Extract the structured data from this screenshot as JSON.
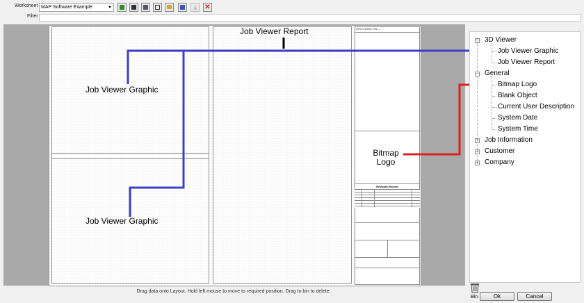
{
  "toolbar": {
    "worksheet_label": "Worksheet",
    "worksheet_value": "MAP Software Example",
    "filter_label": "Filter"
  },
  "layout": {
    "title_block_header": "ARCH BASE ON ---",
    "revision_record": "Revision Record"
  },
  "annotations": {
    "job_viewer_report": "Job Viewer Report",
    "job_viewer_graphic_top": "Job Viewer Graphic",
    "job_viewer_graphic_bottom": "Job Viewer Graphic",
    "bitmap_logo": "Bitmap Logo"
  },
  "tree": {
    "viewer3d": "3D Viewer",
    "job_viewer_graphic": "Job Viewer Graphic",
    "job_viewer_report": "Job Viewer Report",
    "general": "General",
    "bitmap_logo": "Bitmap Logo",
    "blank_object": "Blank Object",
    "current_user_description": "Current User Description",
    "system_date": "System Date",
    "system_time": "System Time",
    "job_information": "Job Information",
    "customer": "Customer",
    "company": "Company"
  },
  "status_text": "Drag data onto Layout. Hold left mouse to move to required position. Drag to bin to delete.",
  "bin_label": "Bin",
  "buttons": {
    "ok": "Ok",
    "cancel": "Cancel"
  },
  "colors": {
    "blue_connector": "#3b3fc4",
    "red_connector": "#e01f1f",
    "black_connector": "#000000"
  }
}
